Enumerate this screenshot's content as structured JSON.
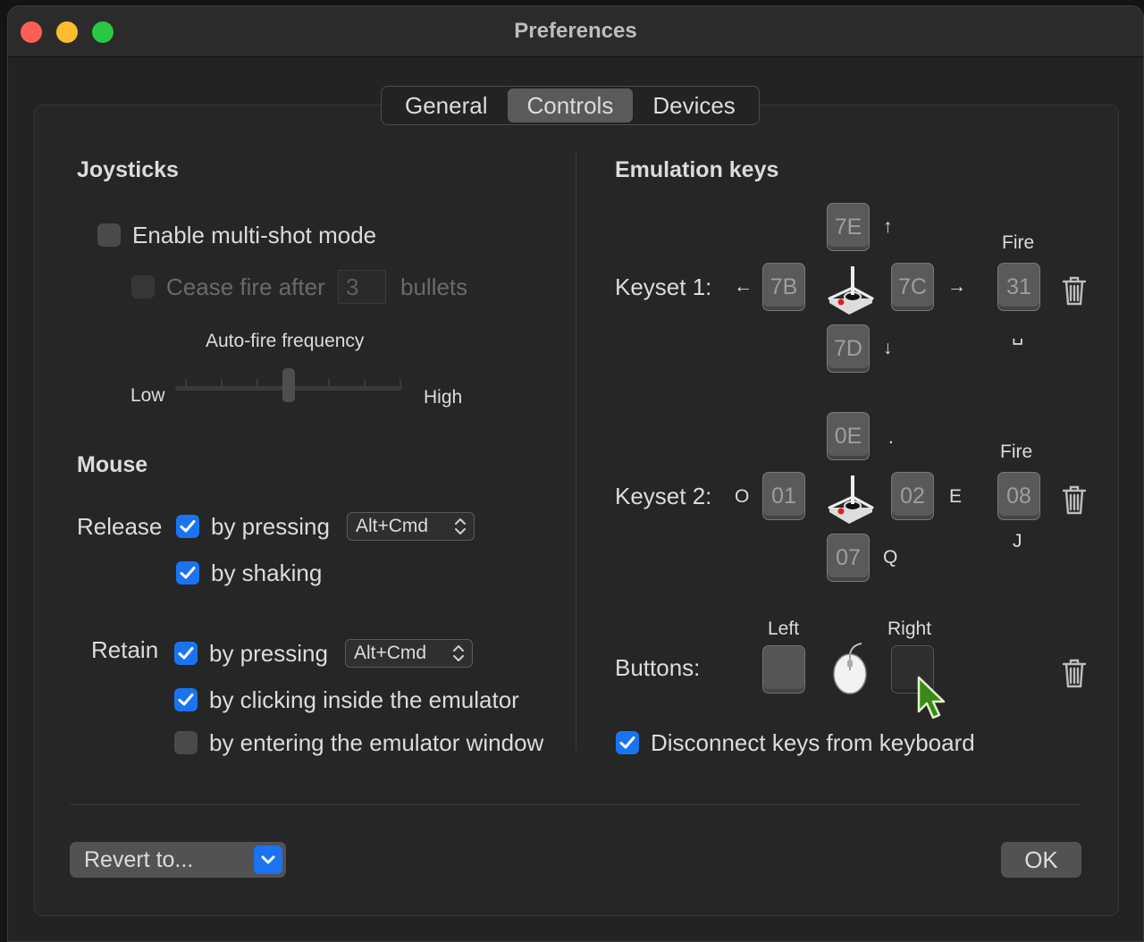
{
  "window": {
    "title": "Preferences"
  },
  "tabs": [
    {
      "label": "General",
      "active": false
    },
    {
      "label": "Controls",
      "active": true
    },
    {
      "label": "Devices",
      "active": false
    }
  ],
  "joysticks": {
    "heading": "Joysticks",
    "multishot_label": "Enable multi-shot mode",
    "multishot_checked": false,
    "cease_fire_label": "Cease fire after",
    "cease_fire_value": "3",
    "cease_fire_suffix": "bullets",
    "autofire_label": "Auto-fire frequency",
    "autofire_low": "Low",
    "autofire_high": "High",
    "autofire_level": 0.5
  },
  "mouse": {
    "heading": "Mouse",
    "release_label": "Release",
    "release_pressing_label": "by pressing",
    "release_pressing_checked": true,
    "release_popup": "Alt+Cmd",
    "release_shaking_label": "by shaking",
    "release_shaking_checked": true,
    "retain_label": "Retain",
    "retain_pressing_label": "by pressing",
    "retain_pressing_checked": true,
    "retain_popup": "Alt+Cmd",
    "retain_clicking_label": "by clicking inside the emulator",
    "retain_clicking_checked": true,
    "retain_entering_label": "by entering the emulator window",
    "retain_entering_checked": false
  },
  "emulation": {
    "heading": "Emulation keys",
    "keyset1": {
      "label": "Keyset 1:",
      "up": "7E",
      "up_hint": "↑",
      "left": "7B",
      "left_hint": "←",
      "right": "7C",
      "right_hint": "→",
      "down": "7D",
      "down_hint": "↓",
      "fire_label": "Fire",
      "fire": "31",
      "fire_hint": "␣"
    },
    "keyset2": {
      "label": "Keyset 2:",
      "up": "0E",
      "up_hint": ".",
      "left": "01",
      "left_hint": "O",
      "right": "02",
      "right_hint": "E",
      "down": "07",
      "down_hint": "Q",
      "fire_label": "Fire",
      "fire": "08",
      "fire_hint": "J"
    },
    "buttons": {
      "label": "Buttons:",
      "left_label": "Left",
      "right_label": "Right"
    },
    "disconnect_label": "Disconnect keys from keyboard",
    "disconnect_checked": true
  },
  "footer": {
    "revert_label": "Revert to...",
    "ok_label": "OK"
  },
  "colors": {
    "accent": "#1a74f2",
    "background": "#232323"
  }
}
